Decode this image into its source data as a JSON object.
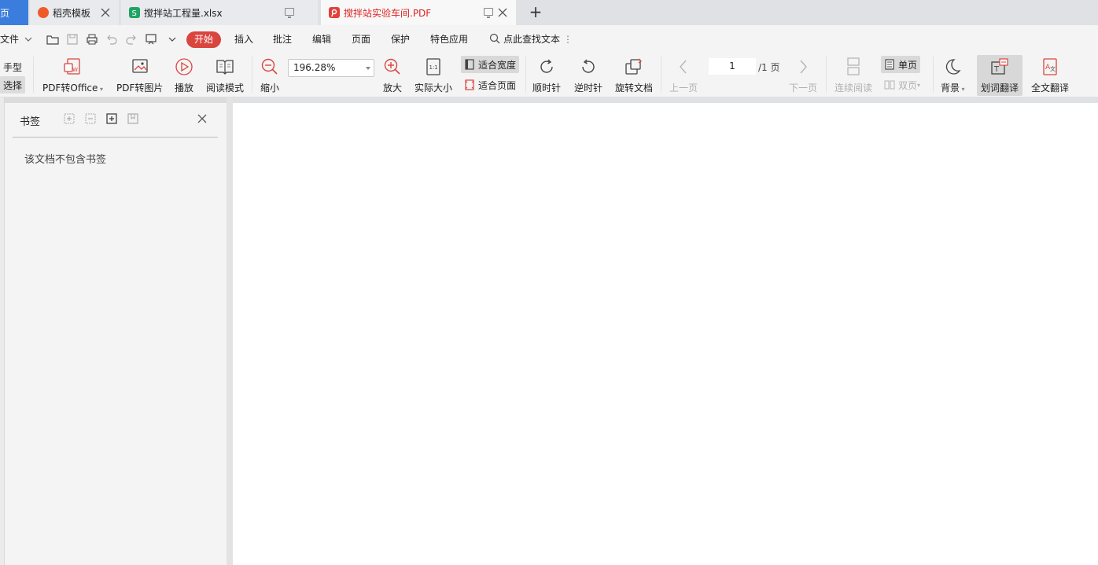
{
  "tabs": {
    "home_label": "页",
    "daoke_label": "稻壳模板",
    "xlsx_label": "搅拌站工程量.xlsx",
    "pdf_label": "搅拌站实验车间.PDF"
  },
  "menubar": {
    "file_label": "文件",
    "items": [
      "开始",
      "插入",
      "批注",
      "编辑",
      "页面",
      "保护",
      "特色应用"
    ],
    "search_label": "点此查找文本"
  },
  "ribbon": {
    "hand_label": "手型",
    "select_label": "选择",
    "pdf_to_office": "PDF转Office",
    "pdf_to_image": "PDF转图片",
    "play": "播放",
    "reading_mode": "阅读模式",
    "zoom_out": "缩小",
    "zoom_value": "196.28%",
    "zoom_in": "放大",
    "actual_size": "实际大小",
    "fit_width": "适合宽度",
    "fit_page": "适合页面",
    "clockwise": "顺时针",
    "counterclockwise": "逆时针",
    "rotate_doc": "旋转文档",
    "prev_page": "上一页",
    "page_current": "1",
    "page_total": "/1 页",
    "next_page": "下一页",
    "continuous": "连续阅读",
    "single_page": "单页",
    "double_page": "双页",
    "background": "背景",
    "word_translate": "划词翻译",
    "full_translate": "全文翻译"
  },
  "sidebar": {
    "title": "书签",
    "empty_text": "该文档不包含书签"
  },
  "colors": {
    "accent": "#d9453f",
    "pdf_tab_text": "#dd2222",
    "home_tab": "#3b7ddd"
  }
}
